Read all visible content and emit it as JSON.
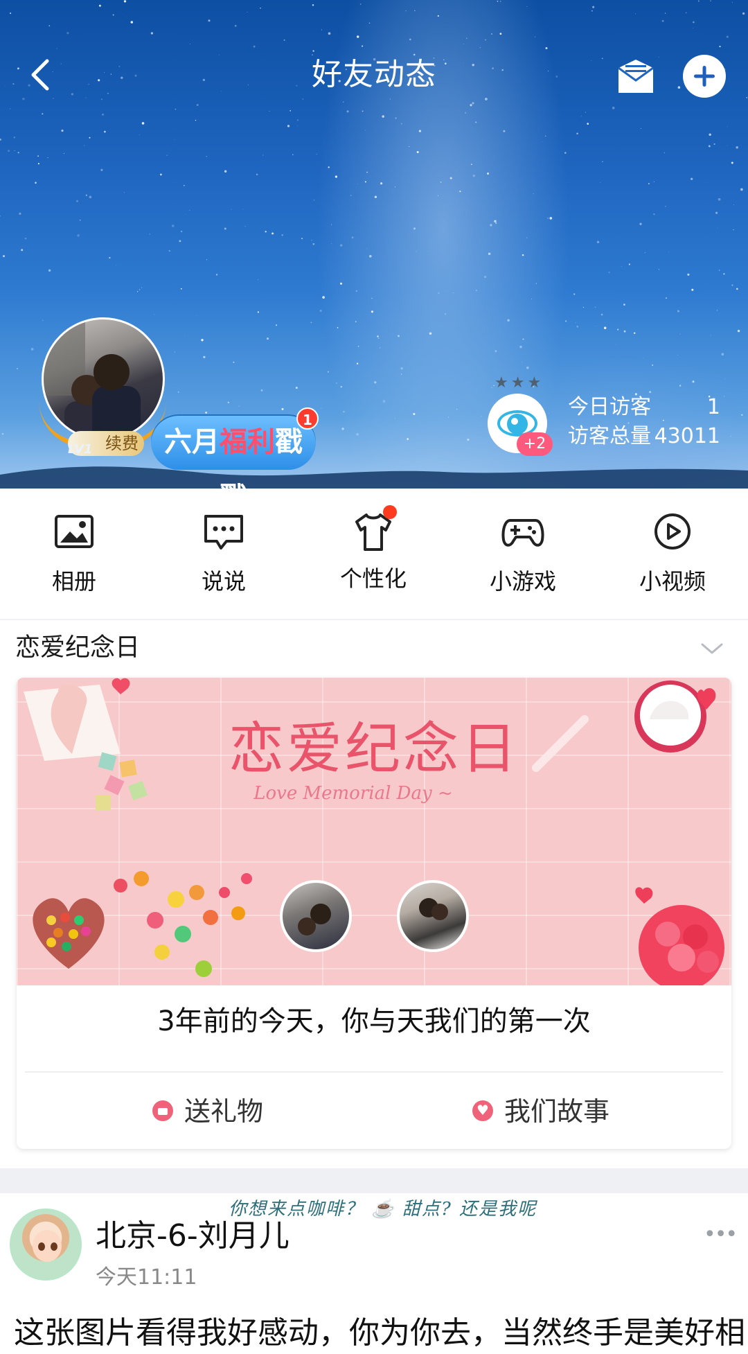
{
  "header": {
    "title": "好友动态",
    "back_icon": "chevron-left-icon",
    "mail_icon": "mail-icon",
    "add_icon": "plus-icon"
  },
  "profile": {
    "level": "LV1",
    "renew_label": "续费",
    "promo": {
      "part1": "六月",
      "highlight": "福利",
      "part2": "戳戳",
      "badge_count": "1"
    },
    "visitors": {
      "today_label": "今日访客",
      "today_value": "1",
      "total_label": "访客总量",
      "total_value": "43011",
      "stars": "★★★",
      "plus_badge": "+2"
    }
  },
  "shortcuts": [
    {
      "label": "相册",
      "icon": "image-icon"
    },
    {
      "label": "说说",
      "icon": "chat-bubble-icon"
    },
    {
      "label": "个性化",
      "icon": "tshirt-icon",
      "has_dot": true
    },
    {
      "label": "小游戏",
      "icon": "gamepad-icon"
    },
    {
      "label": "小视频",
      "icon": "play-circle-icon"
    }
  ],
  "memorial": {
    "section_title": "恋爱纪念日",
    "banner_title": "恋爱纪念日",
    "banner_subtitle": "Love Memorial Day ~",
    "message": "3年前的今天，你与天我们的第一次",
    "actions": [
      {
        "label": "送礼物",
        "icon": "gift-icon"
      },
      {
        "label": "我们故事",
        "icon": "heart-icon"
      }
    ]
  },
  "post": {
    "banner_text": "你想来点咖啡？ ☕ 甜点? 还是我呢",
    "author": "北京-6-刘月儿",
    "time": "今天11:11",
    "more": "•••",
    "body": "这张图片看得我好感动，你为你去，当然终手是美好相"
  },
  "colors": {
    "accent_blue": "#1f66c0",
    "pink": "#f0627a",
    "badge_red": "#ff3b30",
    "eye_blue": "#33b5e6"
  }
}
